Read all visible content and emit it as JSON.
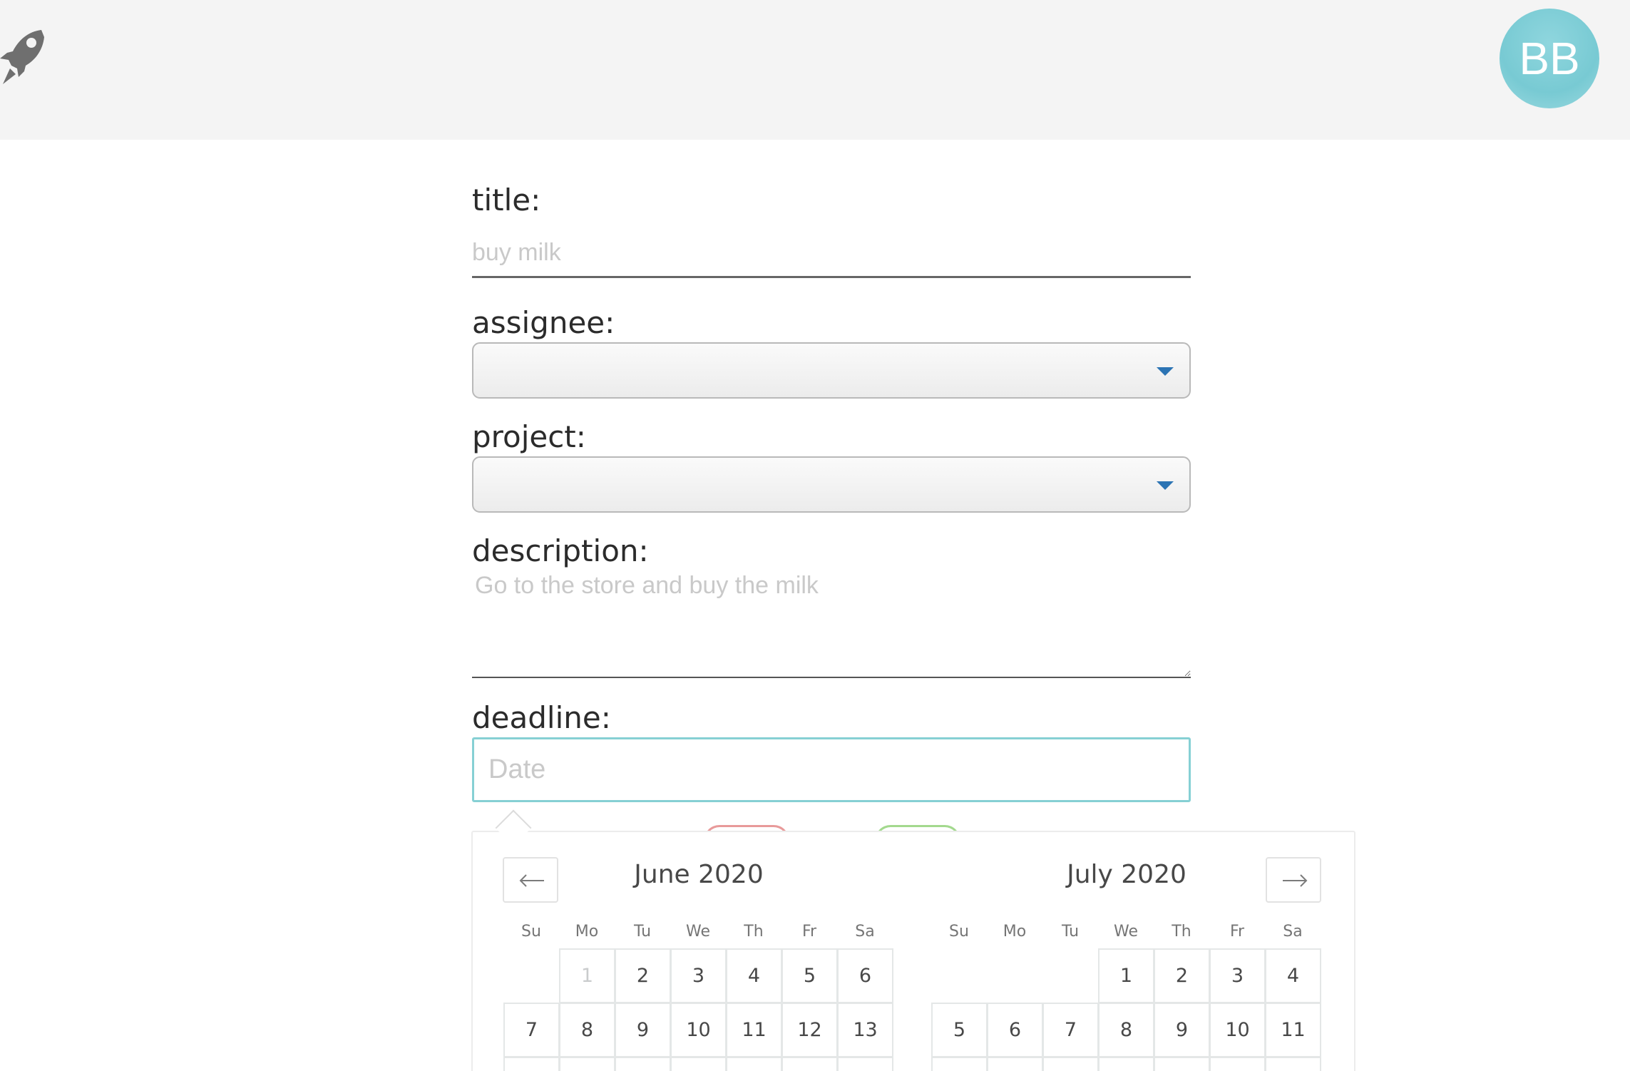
{
  "header": {
    "logo_icon": "rocket-icon",
    "avatar_initials": "BB",
    "avatar_color": "#78cad3"
  },
  "form": {
    "title_label": "title:",
    "title_placeholder": "buy milk",
    "assignee_label": "assignee:",
    "assignee_value": "",
    "project_label": "project:",
    "project_value": "",
    "description_label": "description:",
    "description_placeholder": "Go to the store and buy the milk",
    "deadline_label": "deadline:",
    "deadline_placeholder": "Date"
  },
  "calendar": {
    "prev_icon": "arrow-left-icon",
    "next_icon": "arrow-right-icon",
    "weekdays": [
      "Su",
      "Mo",
      "Tu",
      "We",
      "Th",
      "Fr",
      "Sa"
    ],
    "months": [
      {
        "title": "June 2020",
        "weeks": [
          [
            "",
            "1",
            "2",
            "3",
            "4",
            "5",
            "6"
          ],
          [
            "7",
            "8",
            "9",
            "10",
            "11",
            "12",
            "13"
          ]
        ],
        "disabled": [
          "1"
        ]
      },
      {
        "title": "July 2020",
        "weeks": [
          [
            "",
            "",
            "",
            "1",
            "2",
            "3",
            "4"
          ],
          [
            "5",
            "6",
            "7",
            "8",
            "9",
            "10",
            "11"
          ]
        ],
        "disabled": []
      }
    ]
  }
}
